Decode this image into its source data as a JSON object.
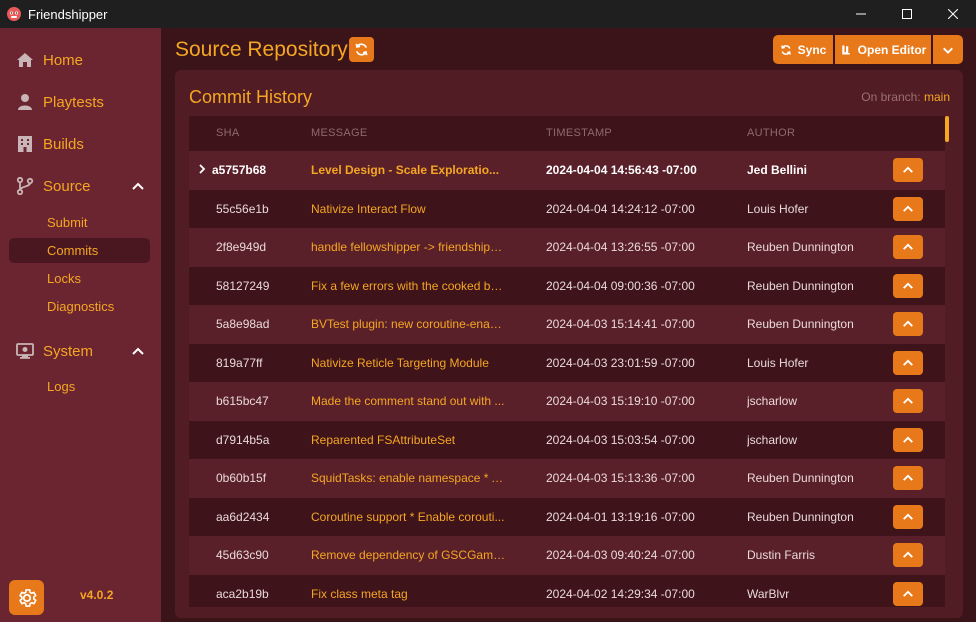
{
  "window": {
    "title": "Friendshipper"
  },
  "sidebar": {
    "items": [
      {
        "label": "Home",
        "icon": "home-icon"
      },
      {
        "label": "Playtests",
        "icon": "person-icon"
      },
      {
        "label": "Builds",
        "icon": "building-icon"
      },
      {
        "label": "Source",
        "icon": "git-branch-icon"
      },
      {
        "label": "System",
        "icon": "monitor-icon"
      }
    ],
    "source_sub": [
      "Submit",
      "Commits",
      "Locks",
      "Diagnostics"
    ],
    "system_sub": [
      "Logs"
    ],
    "active_sub": "Commits",
    "version": "v4.0.2"
  },
  "header": {
    "title": "Source Repository",
    "sync_label": "Sync",
    "open_editor_label": "Open Editor"
  },
  "panel": {
    "title": "Commit History",
    "branch_prefix": "On branch:",
    "branch_name": "main"
  },
  "table": {
    "columns": [
      "SHA",
      "MESSAGE",
      "TIMESTAMP",
      "AUTHOR"
    ],
    "rows": [
      {
        "sha": "a5757b68",
        "message": "Level Design - Scale Exploratio...",
        "timestamp": "2024-04-04 14:56:43 -07:00",
        "author": "Jed Bellini"
      },
      {
        "sha": "55c56e1b",
        "message": "Nativize Interact Flow",
        "timestamp": "2024-04-04 14:24:12 -07:00",
        "author": "Louis Hofer"
      },
      {
        "sha": "2f8e949d",
        "message": "handle fellowshipper -> friendshipp...",
        "timestamp": "2024-04-04 13:26:55 -07:00",
        "author": "Reuben Dunnington"
      },
      {
        "sha": "58127249",
        "message": "Fix a few errors with the cooked bui...",
        "timestamp": "2024-04-04 09:00:36 -07:00",
        "author": "Reuben Dunnington"
      },
      {
        "sha": "5a8e98ad",
        "message": "BVTest plugin: new coroutine-enabl...",
        "timestamp": "2024-04-03 15:14:41 -07:00",
        "author": "Reuben Dunnington"
      },
      {
        "sha": "819a77ff",
        "message": "Nativize Reticle Targeting Module",
        "timestamp": "2024-04-03 23:01:59 -07:00",
        "author": "Louis Hofer"
      },
      {
        "sha": "b615bc47",
        "message": "Made the comment stand out with ...",
        "timestamp": "2024-04-03 15:19:10 -07:00",
        "author": "jscharlow"
      },
      {
        "sha": "d7914b5a",
        "message": "Reparented FSAttributeSet",
        "timestamp": "2024-04-03 15:03:54 -07:00",
        "author": "jscharlow"
      },
      {
        "sha": "0b60b15f",
        "message": "SquidTasks: enable namespace * Als...",
        "timestamp": "2024-04-03 15:13:36 -07:00",
        "author": "Reuben Dunnington"
      },
      {
        "sha": "aa6d2434",
        "message": "Coroutine support * Enable corouti...",
        "timestamp": "2024-04-01 13:19:16 -07:00",
        "author": "Reuben Dunnington"
      },
      {
        "sha": "45d63c90",
        "message": "Remove dependency of GSCGame...",
        "timestamp": "2024-04-03 09:40:24 -07:00",
        "author": "Dustin Farris"
      },
      {
        "sha": "aca2b19b",
        "message": "Fix class meta tag",
        "timestamp": "2024-04-02 14:29:34 -07:00",
        "author": "WarBlvr"
      }
    ]
  },
  "colors": {
    "accent": "#e8791a",
    "text_accent": "#f5a623",
    "sidebar": "#6b2530",
    "panel": "#521c24",
    "background": "#3a1418"
  }
}
